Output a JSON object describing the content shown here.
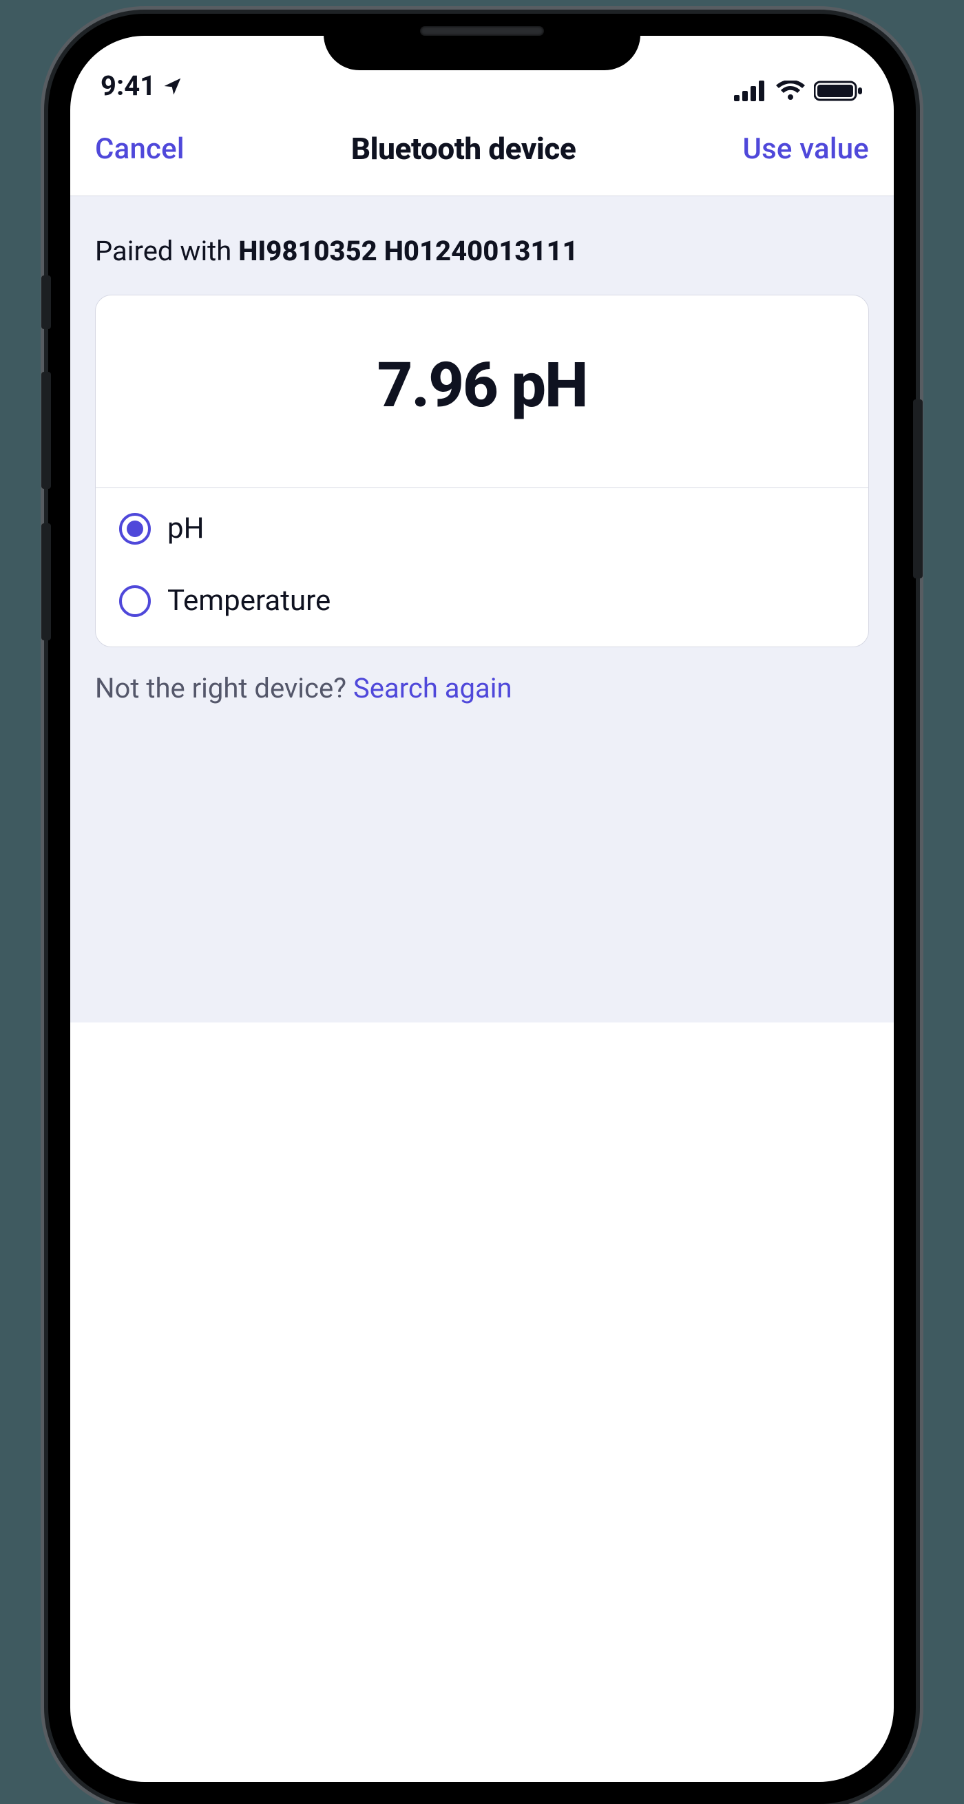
{
  "status": {
    "time": "9:41",
    "icons": {
      "location": "location-arrow-icon",
      "signal": "cellular-signal-icon",
      "wifi": "wifi-icon",
      "battery": "battery-icon"
    }
  },
  "nav": {
    "cancel": "Cancel",
    "title": "Bluetooth device",
    "use_value": "Use value"
  },
  "paired": {
    "prefix": "Paired with ",
    "device_id": "HI9810352 H01240013111"
  },
  "reading": {
    "display": "7.96 pH",
    "value": 7.96,
    "unit": "pH"
  },
  "options": {
    "items": [
      {
        "label": "pH",
        "selected": true
      },
      {
        "label": "Temperature",
        "selected": false
      }
    ]
  },
  "footer": {
    "prompt": "Not the right device? ",
    "link": "Search again"
  },
  "colors": {
    "accent": "#4f48da",
    "panel_bg": "#eef0f8",
    "text": "#0f1220",
    "muted": "#54576a",
    "border": "#d7d9e4"
  }
}
